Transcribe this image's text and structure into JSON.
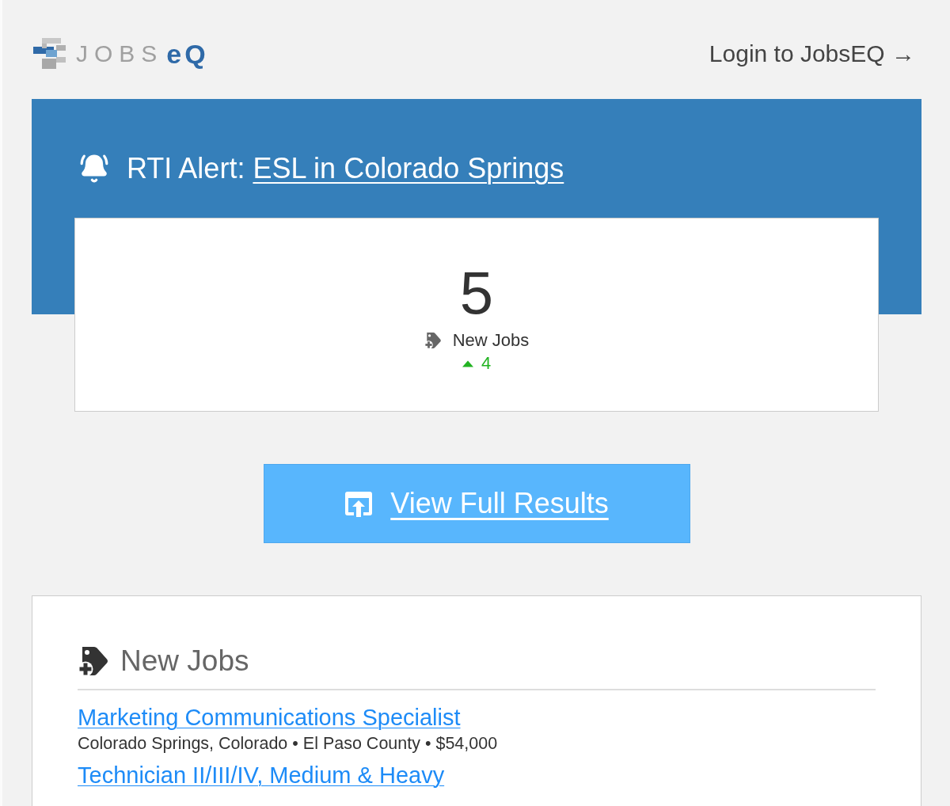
{
  "header": {
    "logo": {
      "word": "JOBS",
      "mark": "eQ"
    },
    "login_link": "Login to JobsEQ →"
  },
  "alert": {
    "label": "RTI Alert:",
    "link": "ESL in Colorado Springs"
  },
  "summary": {
    "count": "5",
    "label": "New Jobs",
    "change": {
      "increased": true,
      "value": "4"
    }
  },
  "view_button": {
    "label": "View Full Results"
  },
  "new_jobs": {
    "title": "New Jobs",
    "jobs": [
      {
        "title": "Marketing Communications Specialist",
        "details": "Colorado Springs, Colorado • El Paso County • $54,000"
      },
      {
        "title": "Technician II/III/IV, Medium & Heavy"
      }
    ]
  }
}
